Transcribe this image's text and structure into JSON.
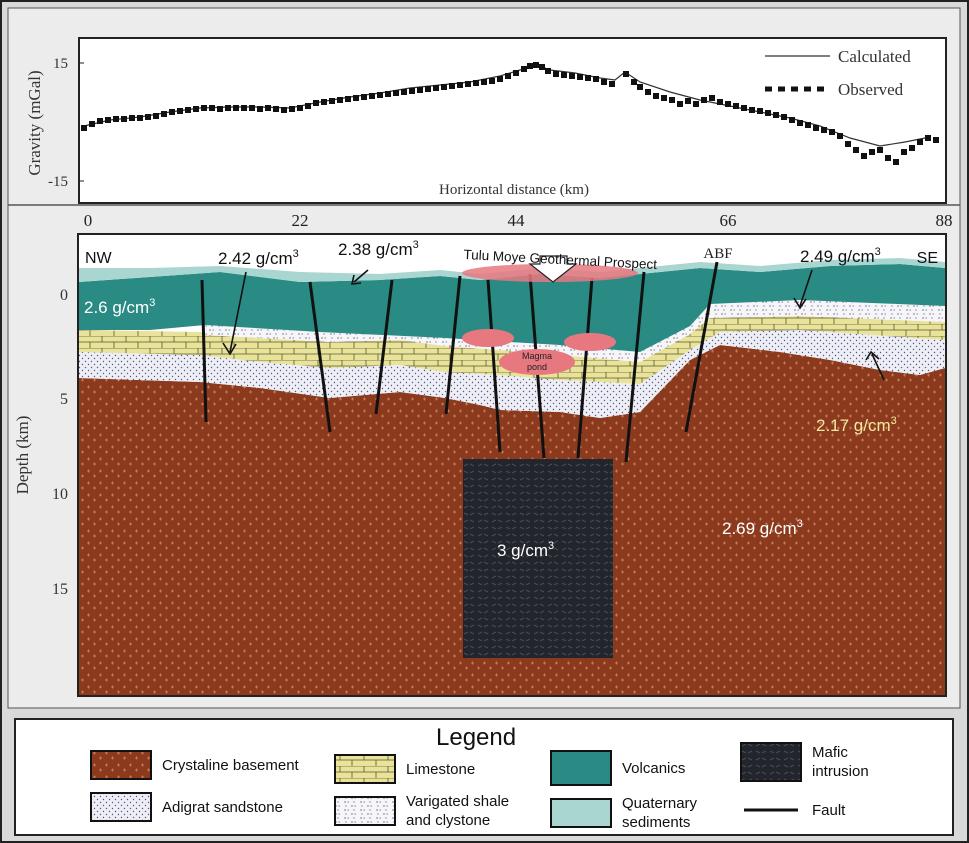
{
  "gravity_panel": {
    "y_axis_label": "Gravity (mGal)",
    "y_ticks": [
      "15",
      "-15"
    ],
    "x_axis_label": "Horizontal distance (km)",
    "legend": {
      "calculated": "Calculated",
      "observed": "Observed"
    }
  },
  "distance_axis": {
    "ticks": [
      "0",
      "22",
      "44",
      "66",
      "88"
    ]
  },
  "section": {
    "y_axis_label": "Depth (km)",
    "depth_ticks": [
      "0",
      "5",
      "10",
      "15"
    ],
    "left_label": "NW",
    "right_label": "SE",
    "prospect_label": "Tulu Moye Geothermal Prospect",
    "fault_label": "ABF",
    "magma_label_line1": "Magma",
    "magma_label_line2": "pond",
    "densities": {
      "volcanics": "2.6 g/cm",
      "limestone": "2.42 g/cm",
      "quaternary": "2.38 g/cm",
      "shale": "2.49 g/cm",
      "sandstone": "2.17 g/cm",
      "basement": "2.69 g/cm",
      "intrusion": "3 g/cm",
      "superscript": "3"
    }
  },
  "legend": {
    "title": "Legend",
    "items": [
      {
        "label": "Crystaline basement",
        "pattern": "basement"
      },
      {
        "label": "Limestone",
        "pattern": "limestone"
      },
      {
        "label": "Volcanics",
        "pattern": "volcanics"
      },
      {
        "label": "Mafic intrusion",
        "pattern": "intrusion"
      },
      {
        "label": "Adigrat sandstone",
        "pattern": "sandstone"
      },
      {
        "label": "Varigated shale and clystone",
        "pattern": "shale"
      },
      {
        "label": "Quaternary sediments",
        "pattern": "quaternary"
      },
      {
        "label": "Fault",
        "pattern": "fault"
      }
    ]
  },
  "colors": {
    "basement": "#8b3a1e",
    "volcanics": "#2a8a84",
    "quaternary": "#a9d6d1",
    "limestone": "#e9e29a",
    "intrusion": "#22252c",
    "magma": "#e87880",
    "panel_bg": "#ededed"
  }
}
